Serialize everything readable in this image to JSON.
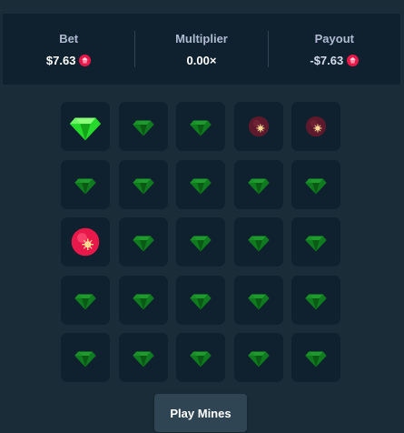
{
  "stats": {
    "bet_label": "Bet",
    "bet_value": "$7.63",
    "multiplier_label": "Multiplier",
    "multiplier_value": "0.00×",
    "payout_label": "Payout",
    "payout_value": "-$7.63",
    "currency_icon": "ruby-coin-icon"
  },
  "colors": {
    "background": "#1a2c38",
    "panel": "#0f212e",
    "button": "#2f4553",
    "gem_revealed": "#27d82d",
    "gem_dim": "#0f7a1f",
    "mine_red": "#e8194a",
    "mine_dim": "#5e1a2c",
    "label": "#b1bad3"
  },
  "board": {
    "rows": 5,
    "cols": 5,
    "tiles": [
      [
        "gem-revealed",
        "gem",
        "gem",
        "mine-dim",
        "mine-dim"
      ],
      [
        "gem",
        "gem",
        "gem",
        "gem",
        "gem"
      ],
      [
        "mine-hit",
        "gem",
        "gem",
        "gem",
        "gem"
      ],
      [
        "gem",
        "gem",
        "gem",
        "gem",
        "gem"
      ],
      [
        "gem",
        "gem",
        "gem",
        "gem",
        "gem"
      ]
    ]
  },
  "play_button": {
    "label": "Play Mines"
  }
}
